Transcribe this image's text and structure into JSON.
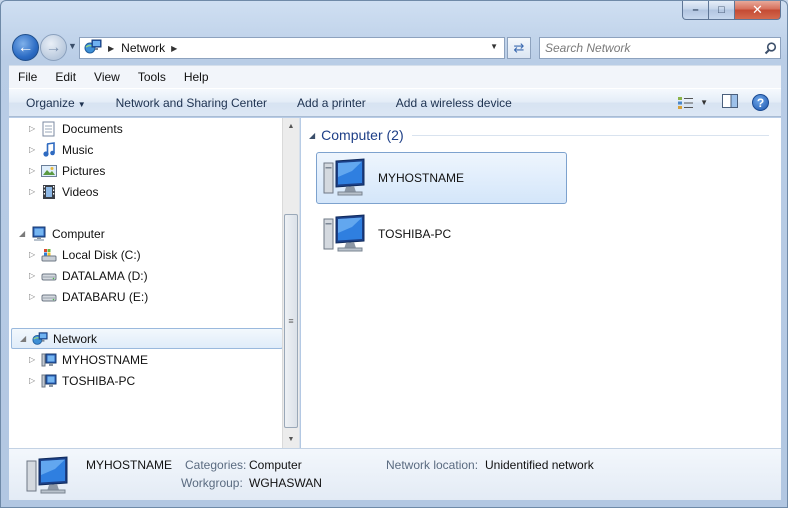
{
  "window": {
    "caption": {
      "minimize": "–",
      "maximize": "□",
      "close": "✕"
    }
  },
  "address": {
    "icon": "network-icon",
    "crumbs": [
      "Network"
    ],
    "search_placeholder": "Search Network"
  },
  "menu": [
    "File",
    "Edit",
    "View",
    "Tools",
    "Help"
  ],
  "commands": {
    "organize": "Organize",
    "sharing_center": "Network and Sharing Center",
    "add_printer": "Add a printer",
    "add_wireless": "Add a wireless device"
  },
  "nav_tree": {
    "libraries": [
      {
        "label": "Documents",
        "icon": "documents-icon"
      },
      {
        "label": "Music",
        "icon": "music-icon"
      },
      {
        "label": "Pictures",
        "icon": "pictures-icon"
      },
      {
        "label": "Videos",
        "icon": "videos-icon"
      }
    ],
    "computer": {
      "label": "Computer",
      "drives": [
        {
          "label": "Local Disk (C:)",
          "icon": "system-drive-icon"
        },
        {
          "label": "DATALAMA (D:)",
          "icon": "drive-icon"
        },
        {
          "label": "DATABARU (E:)",
          "icon": "drive-icon"
        }
      ]
    },
    "network": {
      "label": "Network",
      "hosts": [
        {
          "label": "MYHOSTNAME"
        },
        {
          "label": "TOSHIBA-PC"
        }
      ]
    }
  },
  "content": {
    "group_title": "Computer (2)",
    "items": [
      {
        "name": "MYHOSTNAME",
        "selected": true
      },
      {
        "name": "TOSHIBA-PC",
        "selected": false
      }
    ]
  },
  "details": {
    "name": "MYHOSTNAME",
    "categories_label": "Categories:",
    "categories_value": "Computer",
    "workgroup_label": "Workgroup:",
    "workgroup_value": "WGHASWAN",
    "location_label": "Network location:",
    "location_value": "Unidentified network"
  },
  "colors": {
    "accent": "#1e3f87",
    "selection_border": "#7da2ce",
    "chrome": "#b9cde6"
  }
}
